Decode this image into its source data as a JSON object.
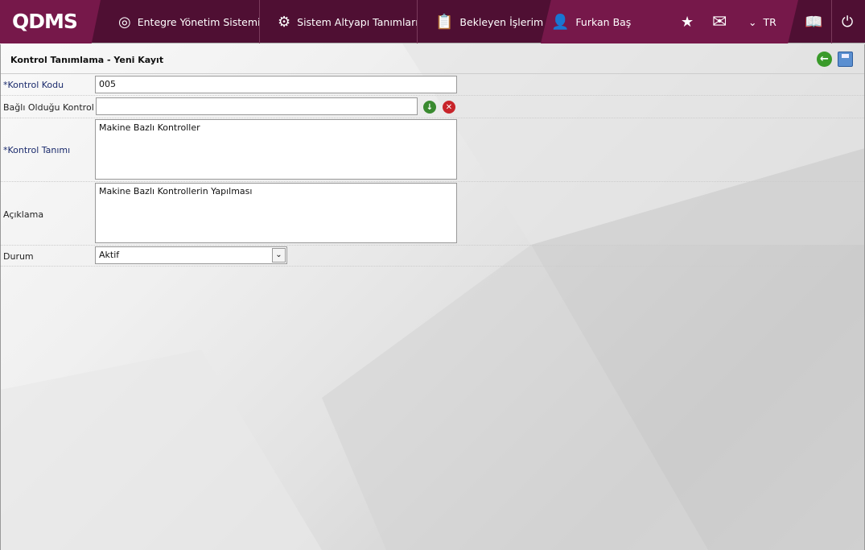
{
  "nav": {
    "logo": "QDMS",
    "items": [
      {
        "label": "Entegre Yönetim Sistemi",
        "icon": "q-logo-icon"
      },
      {
        "label": "Sistem Altyapı Tanımları",
        "icon": "gear-icon"
      },
      {
        "label": "Bekleyen İşlerim",
        "icon": "clipboard-icon"
      }
    ],
    "user": "Furkan Baş",
    "language": "TR"
  },
  "form": {
    "title": "Kontrol Tanımlama - Yeni Kayıt",
    "fields": {
      "kod_label": "*Kontrol Kodu",
      "kod_value": "005",
      "bagli_label": "Bağlı Olduğu Kontrol",
      "bagli_value": "",
      "tanim_label": "*Kontrol Tanımı",
      "tanim_value": "Makine Bazlı Kontroller",
      "aciklama_label": "Açıklama",
      "aciklama_value": "Makine Bazlı Kontrollerin Yapılması",
      "durum_label": "Durum",
      "durum_value": "Aktif"
    }
  },
  "colors": {
    "nav_dark": "#4f0f33",
    "nav_accent": "#76184a",
    "required_label": "#1a2a6c"
  }
}
